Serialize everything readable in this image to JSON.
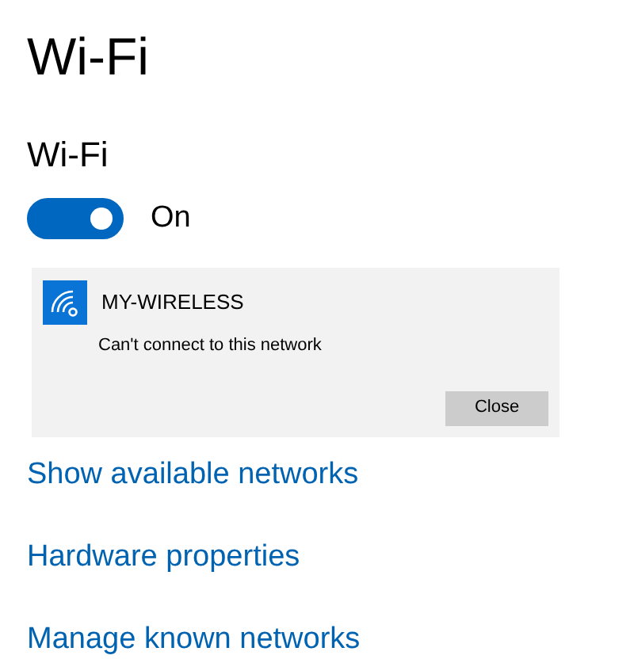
{
  "page_title": "Wi-Fi",
  "section_title": "Wi-Fi",
  "toggle": {
    "on": true,
    "label": "On"
  },
  "network": {
    "name": "MY-WIRELESS",
    "message": "Can't connect to this network",
    "button": "Close"
  },
  "links": [
    "Show available networks",
    "Hardware properties",
    "Manage known networks"
  ]
}
